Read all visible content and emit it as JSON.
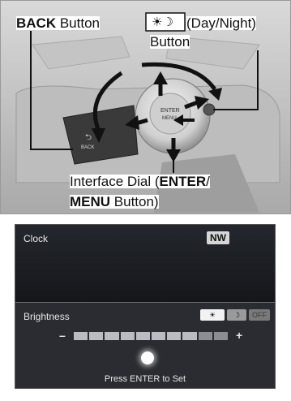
{
  "callouts": {
    "back_bold": "BACK",
    "back_rest": " Button",
    "daynight_icons": "☀☽",
    "daynight_rest": " (Day/Night)",
    "daynight_line2": "Button",
    "dial_line1_plain": "Interface Dial (",
    "dial_line1_bold": "ENTER",
    "dial_line1_end": "/",
    "dial_line2_bold": "MENU",
    "dial_line2_rest": " Button)"
  },
  "console": {
    "back_key_text": "BACK",
    "dial_text_1": "ENTER",
    "dial_text_2": "MENU"
  },
  "screen": {
    "clock_label": "Clock",
    "heading_badge": "NW",
    "brightness_label": "Brightness",
    "option_day": "☀",
    "option_night": "☽",
    "option_off": "OFF",
    "minus": "–",
    "plus": "+",
    "brightness_level": 0.8,
    "hint": "Press ENTER to Set"
  }
}
